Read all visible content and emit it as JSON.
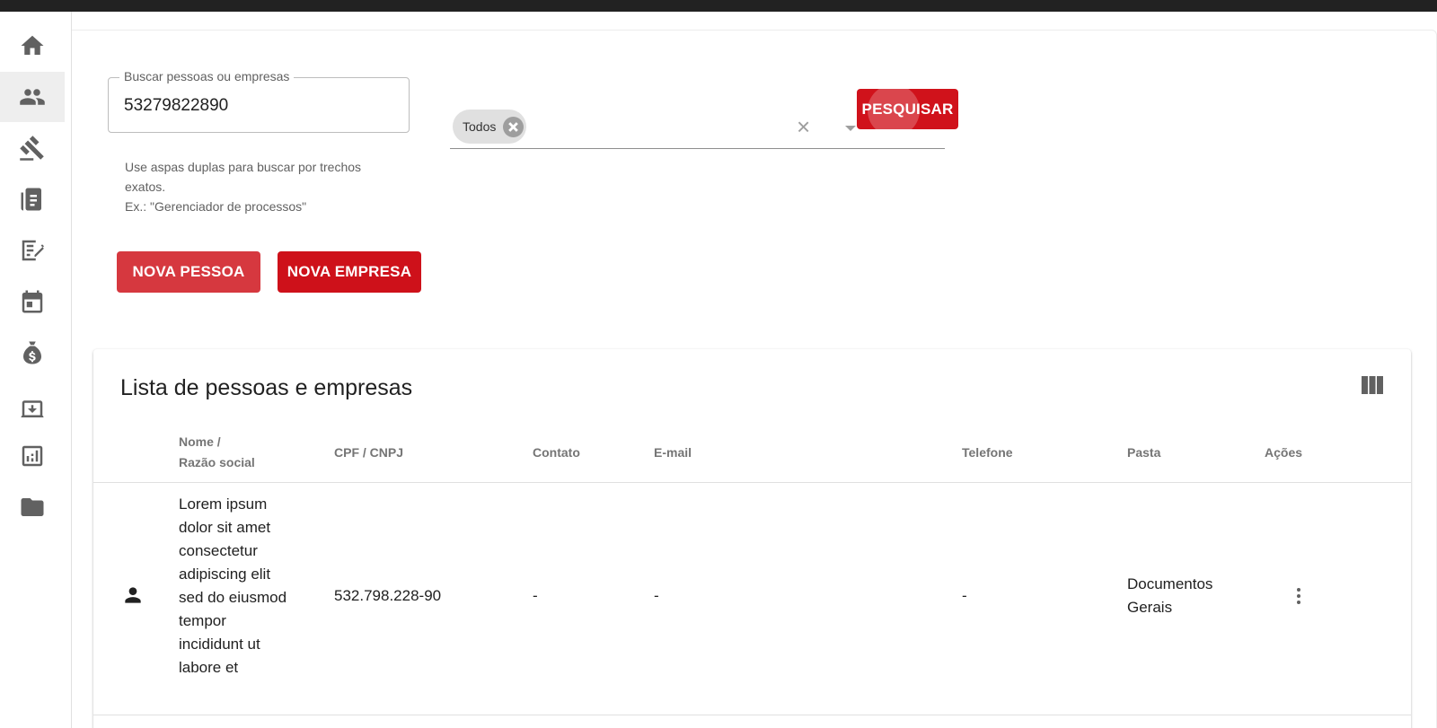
{
  "sidebar": {
    "items": [
      {
        "name": "home",
        "icon": "home-icon",
        "active": false
      },
      {
        "name": "people",
        "icon": "people-icon",
        "active": true
      },
      {
        "name": "legal",
        "icon": "gavel-icon",
        "active": false
      },
      {
        "name": "documents",
        "icon": "document-icon",
        "active": false
      },
      {
        "name": "contracts",
        "icon": "signature-icon",
        "active": false
      },
      {
        "name": "calendar",
        "icon": "calendar-icon",
        "active": false
      },
      {
        "name": "finance",
        "icon": "money-bag-icon",
        "active": false
      },
      {
        "name": "archive",
        "icon": "archive-icon",
        "active": false
      },
      {
        "name": "reports",
        "icon": "chart-icon",
        "active": false
      },
      {
        "name": "folders",
        "icon": "folder-icon",
        "active": false
      }
    ]
  },
  "search": {
    "label": "Buscar pessoas ou empresas",
    "value": "53279822890",
    "hint_line1": "Use aspas duplas para buscar por trechos exatos.",
    "hint_line2": "Ex.: \"Gerenciador de processos\""
  },
  "filter": {
    "chip_label": "Todos",
    "clear_symbol": "×"
  },
  "buttons": {
    "search": "PESQUISAR",
    "new_person": "NOVA PESSOA",
    "new_company": "NOVA EMPRESA"
  },
  "table": {
    "title": "Lista de pessoas e empresas",
    "headers": {
      "name_line1": "Nome /",
      "name_line2": "Razão social",
      "doc": "CPF / CNPJ",
      "contact": "Contato",
      "email": "E-mail",
      "phone": "Telefone",
      "folder": "Pasta",
      "actions": "Ações"
    },
    "rows": [
      {
        "type_icon": "person-icon",
        "name": "Lorem ipsum dolor sit amet consectetur adipiscing elit sed do eiusmod tempor incididunt ut labore et",
        "doc": "532.798.228-90",
        "contact": "-",
        "email": "-",
        "phone": "-",
        "folder": "Documentos Gerais"
      }
    ]
  },
  "colors": {
    "primary": "#ce111a",
    "primary_light": "#d6383f",
    "sidebar_icon": "#616161",
    "topbar": "#222222"
  }
}
